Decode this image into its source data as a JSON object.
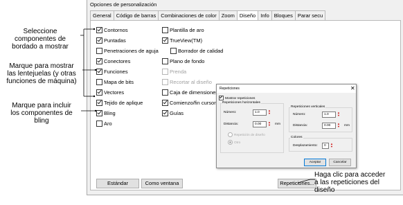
{
  "dialog": {
    "title": "Opciones de personalización",
    "tabs": [
      {
        "label": "General",
        "active": false
      },
      {
        "label": "Código de barras",
        "active": false
      },
      {
        "label": "Combinaciones de color",
        "active": false
      },
      {
        "label": "Zoom",
        "active": false
      },
      {
        "label": "Diseño",
        "active": true
      },
      {
        "label": "Info",
        "active": false
      },
      {
        "label": "Bloques",
        "active": false
      },
      {
        "label": "Parar secu",
        "active": false
      }
    ],
    "column1": [
      {
        "label": "Contornos",
        "checked": true
      },
      {
        "label": "Puntadas",
        "checked": true
      },
      {
        "label": "Penetraciones de aguja",
        "checked": false
      },
      {
        "label": "Conectores",
        "checked": true
      },
      {
        "label": "Funciones",
        "checked": true
      },
      {
        "label": "Mapa de bits",
        "checked": false
      },
      {
        "label": "Vectores",
        "checked": true
      },
      {
        "label": "Tejido de aplique",
        "checked": true
      },
      {
        "label": "Bling",
        "checked": true
      },
      {
        "label": "Aro",
        "checked": false
      }
    ],
    "column2": [
      {
        "label": "Plantilla de aro",
        "checked": false,
        "disabled": false
      },
      {
        "label": "TrueView(TM)",
        "checked": true,
        "disabled": false
      },
      {
        "label": "Borrador de calidad",
        "checked": false,
        "disabled": false
      },
      {
        "label": "Plano de fondo",
        "checked": false,
        "disabled": false
      },
      {
        "label": "Prenda",
        "checked": false,
        "disabled": true
      },
      {
        "label": "Recortar al diseño",
        "checked": false,
        "disabled": true
      },
      {
        "label": "Caja de dimensiones",
        "checked": false,
        "disabled": false
      },
      {
        "label": "Comienzo/fin cursor fo",
        "checked": true,
        "disabled": false
      },
      {
        "label": "Guías",
        "checked": true,
        "disabled": false
      }
    ],
    "buttons": {
      "standard": "Estándar",
      "as_window": "Como ventana",
      "repetitions": "Repeticiones..."
    }
  },
  "callouts": {
    "components": "Seleccione\ncomponentes de\nbordado a mostrar",
    "sequins": "Marque para mostrar\nlas lentejuelas (y otras\nfunciones de máquina)",
    "bling": "Marque para incluir\nlos componentes de\nbling",
    "repetitions": "Haga clic para acceder\na las repeticiones del\ndiseño"
  },
  "repeticiones": {
    "title": "Repeticiones",
    "close_label": "✕",
    "show_label": "Mostrar repeticiones",
    "show_checked": true,
    "horizontal": {
      "group_label": "Repeticiones horizontales",
      "number_label": "Número:",
      "number_value": "1.0",
      "distance_label": "Distancia:",
      "distance_value": "0.00",
      "unit": "mm",
      "radio_design": "Repetición de diseño",
      "radio_other": "Otro"
    },
    "vertical": {
      "group_label": "Repeticiones verticales",
      "number_label": "Número:",
      "number_value": "1.0",
      "distance_label": "Distancia:",
      "distance_value": "0.00",
      "unit": "mm"
    },
    "colors": {
      "group_label": "Colores",
      "shift_label": "Desplazamiento:",
      "shift_value": "0"
    },
    "accept": "Aceptar",
    "cancel": "Cancelar"
  }
}
